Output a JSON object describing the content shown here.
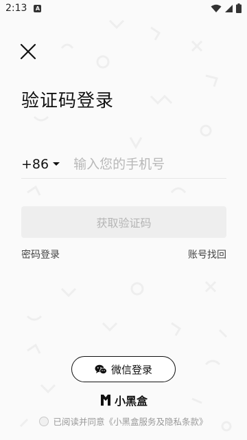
{
  "status_bar": {
    "time": "2:13",
    "notification_icon": "a-notification-icon",
    "wifi_icon": "wifi-icon",
    "signal_icon": "cell-signal-icon",
    "battery_icon": "battery-icon"
  },
  "header": {
    "close_icon": "close-icon",
    "title": "验证码登录"
  },
  "form": {
    "country_code": "+86",
    "phone_placeholder": "输入您的手机号",
    "phone_value": "",
    "get_code_label": "获取验证码"
  },
  "links": {
    "password_login": "密码登录",
    "account_recovery": "账号找回"
  },
  "wechat": {
    "icon": "wechat-icon",
    "label": "微信登录"
  },
  "brand": {
    "logo_icon": "xiaoheihe-logo-icon",
    "name": "小黑盒"
  },
  "agreement": {
    "checked": false,
    "text": "已阅读并同意《小黑盒服务及隐私条款》"
  },
  "colors": {
    "background": "#fafafa",
    "button_disabled_bg": "#eeeeee",
    "button_disabled_text": "#b5b5b5",
    "primary_text": "#111111",
    "placeholder": "#b8b8b8"
  }
}
